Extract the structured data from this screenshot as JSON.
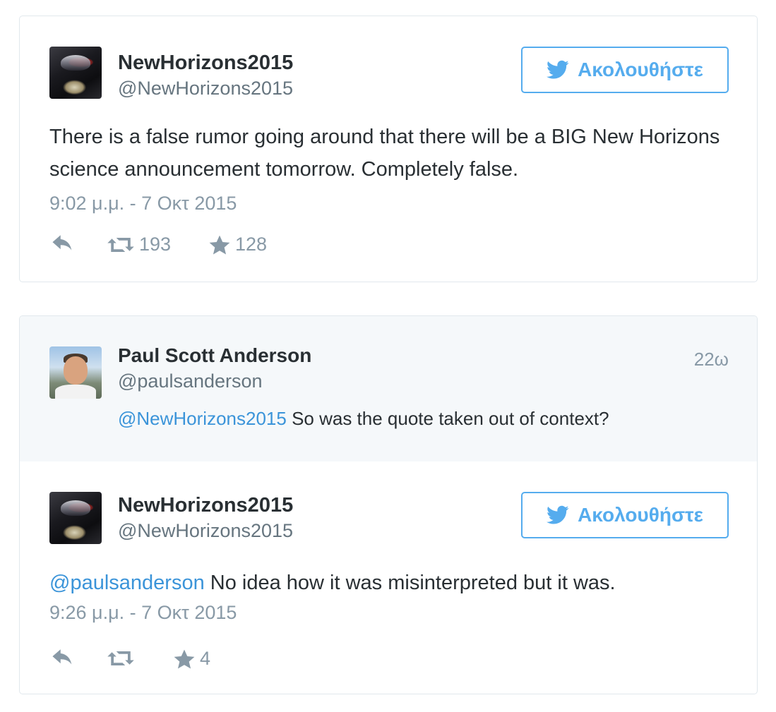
{
  "tweet1": {
    "author_name": "NewHorizons2015",
    "author_handle": "@NewHorizons2015",
    "follow_label": "Ακολουθήστε",
    "text": "There is a false rumor going around that there will be a BIG New Horizons science announcement tomorrow. Completely false.",
    "timestamp": "9:02 μ.μ. - 7 Οκτ 2015",
    "retweet_count": "193",
    "favorite_count": "128",
    "icons": [
      "reply-icon",
      "retweet-icon",
      "favorite-icon",
      "twitter-bird-icon"
    ]
  },
  "reply": {
    "author_name": "Paul Scott Anderson",
    "author_handle": "@paulsanderson",
    "relative_time": "22ω",
    "mention": "@NewHorizons2015",
    "text": " So was the quote taken out of context?"
  },
  "tweet2": {
    "author_name": "NewHorizons2015",
    "author_handle": "@NewHorizons2015",
    "follow_label": "Ακολουθήστε",
    "mention": "@paulsanderson",
    "text": " No idea how it was misinterpreted but it was.",
    "timestamp": "9:26 μ.μ. - 7 Οκτ 2015",
    "favorite_count": "4"
  },
  "colors": {
    "accent": "#55acee",
    "mention": "#3b94d9",
    "muted": "#8899a6",
    "reply_bg": "#f5f8fa"
  }
}
